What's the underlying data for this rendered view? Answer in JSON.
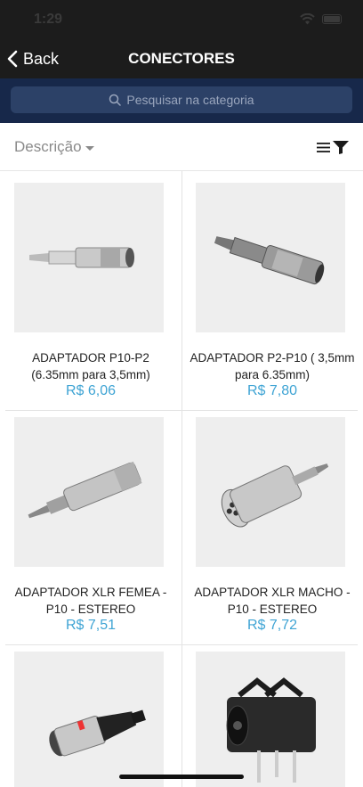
{
  "status_bar": {
    "time": "1:29"
  },
  "nav": {
    "back_label": "Back",
    "title": "CONECTORES"
  },
  "search": {
    "placeholder": "Pesquisar na categoria"
  },
  "sort": {
    "label": "Descrição"
  },
  "colors": {
    "nav_bg": "#1c1c1c",
    "search_bg": "#17284a",
    "price": "#3fa4d4"
  },
  "products": [
    {
      "name": "ADAPTADOR P10-P2 (6.35mm para 3,5mm)",
      "price": "R$ 6,06",
      "image": "p10-p2-adapter"
    },
    {
      "name": "ADAPTADOR P2-P10 ( 3,5mm para 6.35mm)",
      "price": "R$ 7,80",
      "image": "p2-p10-adapter"
    },
    {
      "name": "ADAPTADOR XLR FEMEA - P10 - ESTEREO",
      "price": "R$ 7,51",
      "image": "xlr-female-p10-adapter"
    },
    {
      "name": "ADAPTADOR XLR MACHO - P10 - ESTEREO",
      "price": "R$ 7,72",
      "image": "xlr-male-p10-adapter"
    },
    {
      "name": "",
      "price": "",
      "image": "xlr-female-connector"
    },
    {
      "name": "",
      "price": "",
      "image": "jack-socket"
    }
  ]
}
